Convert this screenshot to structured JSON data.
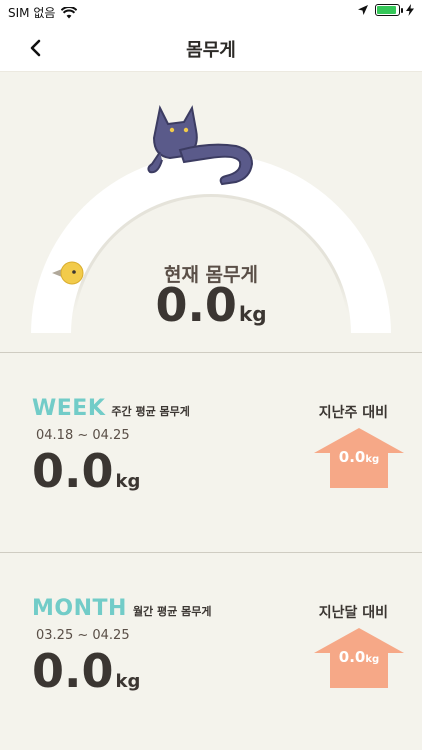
{
  "status_bar": {
    "carrier": "SIM 없음",
    "wifi_icon": "wifi-icon",
    "location_icon": "location-arrow-icon",
    "battery_icon": "battery-icon",
    "charging_icon": "charging-bolt-icon",
    "battery_color": "#35c759"
  },
  "nav": {
    "title": "몸무게",
    "back_icon": "chevron-left-icon"
  },
  "gauge": {
    "mascot": "cat-illustration",
    "indicator_icon": "bird-icon",
    "current_label": "현재 몸무게",
    "current_value": "0.0",
    "unit": "kg"
  },
  "weekly": {
    "period": "WEEK",
    "subtitle": "주간 평균 몸무게",
    "range": "04.18 ~ 04.25",
    "value": "0.0",
    "unit": "kg",
    "compare_label": "지난주 대비",
    "compare_value": "0.0",
    "compare_unit": "kg"
  },
  "monthly": {
    "period": "MONTH",
    "subtitle": "월간 평균 몸무게",
    "range": "03.25 ~ 04.25",
    "value": "0.0",
    "unit": "kg",
    "compare_label": "지난달 대비",
    "compare_value": "0.0",
    "compare_unit": "kg"
  },
  "colors": {
    "background": "#f4f3ec",
    "accent_teal": "#72ccc8",
    "arrow_orange": "#f6a887",
    "cat_purple": "#5a5a8a",
    "bird_yellow": "#f2cb4b"
  }
}
